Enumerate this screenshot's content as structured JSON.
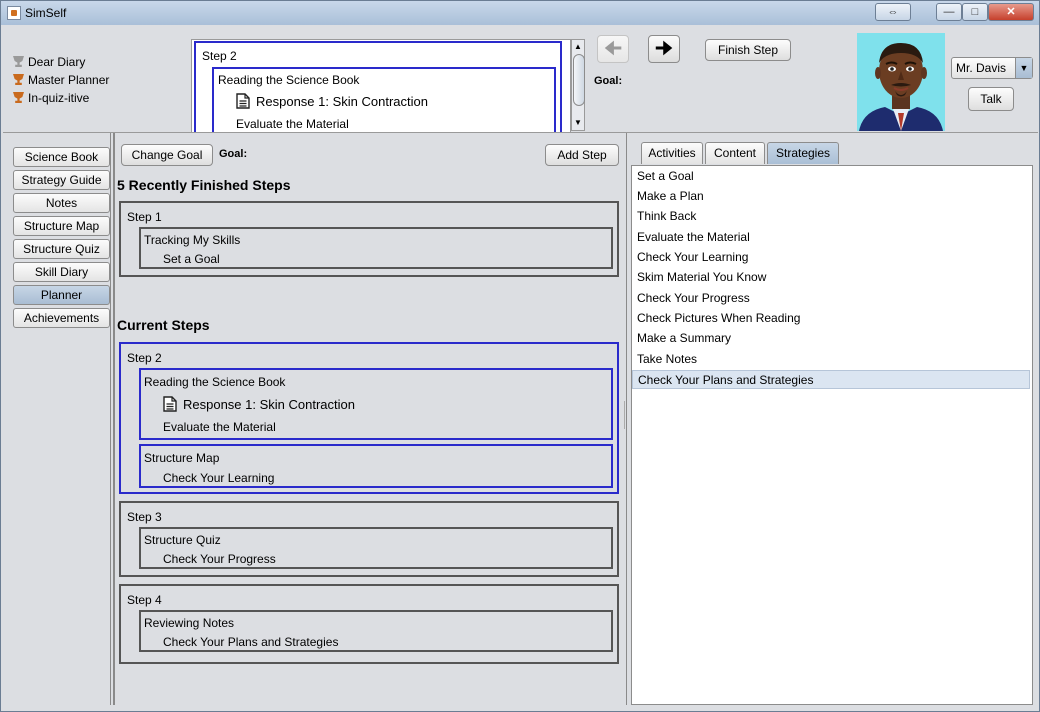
{
  "window": {
    "title": "SimSelf"
  },
  "achievements": [
    {
      "label": "Dear Diary",
      "color": "gray"
    },
    {
      "label": "Master Planner",
      "color": "orange"
    },
    {
      "label": "In-quiz-itive",
      "color": "orange"
    }
  ],
  "mini_plan": {
    "step": "Step 2",
    "activity": "Reading the Science Book",
    "response": "Response 1: Skin Contraction",
    "strategy": "Evaluate the Material"
  },
  "header": {
    "finish_step": "Finish Step",
    "goal_label": "Goal:",
    "tutor_name": "Mr. Davis",
    "talk": "Talk"
  },
  "left_nav": [
    "Science Book",
    "Strategy Guide",
    "Notes",
    "Structure Map",
    "Structure Quiz",
    "Skill Diary",
    "Planner",
    "Achievements"
  ],
  "left_nav_active": "Planner",
  "planner": {
    "change_goal": "Change Goal",
    "goal_label": "Goal:",
    "add_step": "Add Step",
    "finished_heading": "5 Recently Finished Steps",
    "finished_step": {
      "label": "Step 1",
      "activity": "Tracking My Skills",
      "strategy": "Set a Goal"
    },
    "current_heading": "Current Steps",
    "step2": {
      "label": "Step 2",
      "a1_activity": "Reading the Science Book",
      "a1_response": "Response 1: Skin Contraction",
      "a1_strategy": "Evaluate the Material",
      "a2_activity": "Structure Map",
      "a2_strategy": "Check Your Learning"
    },
    "step3": {
      "label": "Step 3",
      "activity": "Structure Quiz",
      "strategy": "Check Your Progress"
    },
    "step4": {
      "label": "Step 4",
      "activity": "Reviewing Notes",
      "strategy": "Check Your Plans and Strategies"
    }
  },
  "right_tabs": [
    "Activities",
    "Content",
    "Strategies"
  ],
  "right_tab_active": "Strategies",
  "strategies": [
    "Set a Goal",
    "Make a Plan",
    "Think Back",
    "Evaluate the Material",
    "Check Your Learning",
    "Skim Material You Know",
    "Check Your Progress",
    "Check Pictures When Reading",
    "Make a Summary",
    "Take Notes",
    "Check Your Plans and Strategies"
  ],
  "strategies_selected": "Check Your Plans and Strategies",
  "colors": {
    "active_border": "#2a2acb",
    "box_border": "#555555",
    "selection": "#dbe5f1"
  }
}
